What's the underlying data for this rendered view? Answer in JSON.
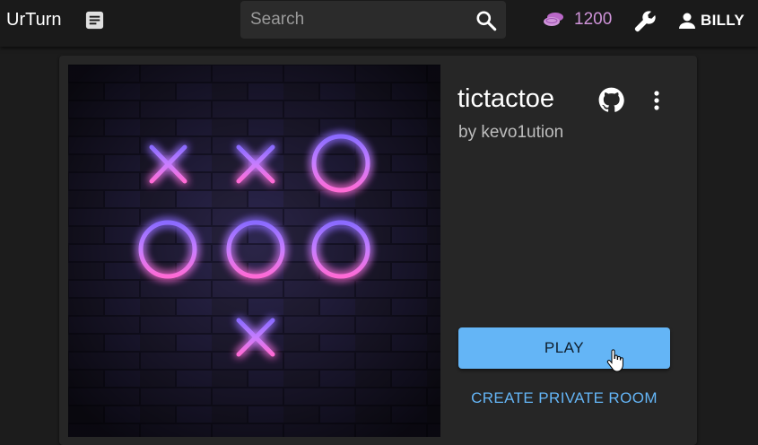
{
  "header": {
    "brand": "UrTurn",
    "search_placeholder": "Search",
    "coins": "1200",
    "username": "BILLY"
  },
  "game": {
    "title": "tictactoe",
    "author": "by kevo1ution",
    "play_label": "PLAY",
    "private_label": "CREATE PRIVATE ROOM"
  },
  "colors": {
    "accent": "#64b5f6",
    "coins": "#ce93d8"
  },
  "icons": [
    "document-icon",
    "search-icon",
    "coins-icon",
    "wrench-icon",
    "user-icon",
    "github-icon",
    "more-vertical-icon",
    "hand-cursor-icon"
  ]
}
